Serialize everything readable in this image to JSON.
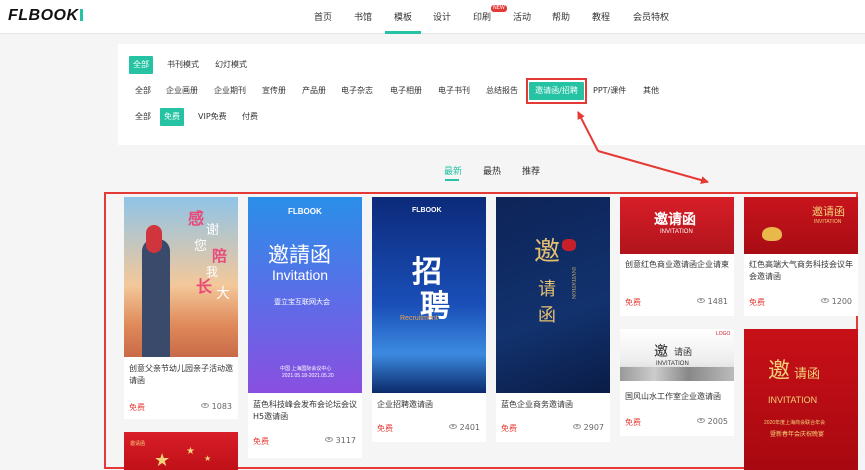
{
  "header": {
    "logo_text": "FLBOOK",
    "nav": [
      {
        "label": "首页"
      },
      {
        "label": "书馆"
      },
      {
        "label": "模板"
      },
      {
        "label": "设计"
      },
      {
        "label": "印刷"
      },
      {
        "label": "活动"
      },
      {
        "label": "帮助"
      },
      {
        "label": "教程"
      },
      {
        "label": "会员特权"
      }
    ],
    "active_nav": "模板",
    "new_badge": "NEW"
  },
  "filters": {
    "mode": {
      "items": [
        "全部",
        "书刊模式",
        "幻灯模式"
      ],
      "selected": "全部"
    },
    "category": {
      "items": [
        "全部",
        "企业画册",
        "企业期刊",
        "宣传册",
        "产品册",
        "电子杂志",
        "电子相册",
        "电子书刊",
        "总结报告",
        "邀请函/招聘",
        "PPT/课件",
        "其他"
      ],
      "selected": "邀请函/招聘"
    },
    "price": {
      "items": [
        "全部",
        "免费",
        "VIP免费",
        "付费"
      ],
      "selected": "免费"
    }
  },
  "sort_tabs": {
    "items": [
      "最新",
      "最热",
      "推荐"
    ],
    "selected": "最新"
  },
  "cards": [
    {
      "title": "创意父亲节幼儿园亲子活动邀请函",
      "price": "免费",
      "views": "1083",
      "thumb_text": [
        "感",
        "谢",
        "您",
        "陪",
        "我",
        "长",
        "大"
      ]
    },
    {
      "title": "蓝色科技峰会发布会论坛会议H5邀请函",
      "price": "免费",
      "views": "3117",
      "thumb_text": [
        "FLBOOK",
        "邀請函",
        "Invitation",
        "壹立宝互联网大会",
        "中国 上海国际会议中心",
        "2021.05.18-2021.05.20"
      ]
    },
    {
      "title": "企业招聘邀请函",
      "price": "免费",
      "views": "2401",
      "thumb_text": [
        "FLBOOK",
        "招",
        "聘",
        "Recruitment"
      ]
    },
    {
      "title": "蓝色企业商务邀请函",
      "price": "免费",
      "views": "2907",
      "thumb_text": [
        "邀",
        "请",
        "函",
        "INVITATION"
      ]
    },
    {
      "title": "创意红色商业邀请函企业请柬",
      "price": "免费",
      "views": "1481",
      "thumb_text": [
        "邀请函",
        "INVITATION"
      ]
    },
    {
      "title": "红色高端大气商务科技会议年会邀请函",
      "price": "免费",
      "views": "1200",
      "thumb_text": [
        "邀请函",
        "INVITATION"
      ]
    },
    {
      "title": "国风山水工作室企业邀请函",
      "price": "免费",
      "views": "2005",
      "thumb_text": [
        "LOGO",
        "邀",
        "请函",
        "INVITATION"
      ]
    },
    {
      "title": "",
      "price": "",
      "views": "",
      "thumb_text": [
        "邀",
        "请函",
        "INVITATION",
        "2020年度上海商会联合年会",
        "暨新春年会庆祝晚宴"
      ]
    },
    {
      "title": "",
      "price": "",
      "views": "",
      "thumb_text": [
        "邀请函"
      ]
    }
  ],
  "colors": {
    "accent": "#25c2a3",
    "annotation_red": "#e53935",
    "price_red": "#e53935"
  }
}
